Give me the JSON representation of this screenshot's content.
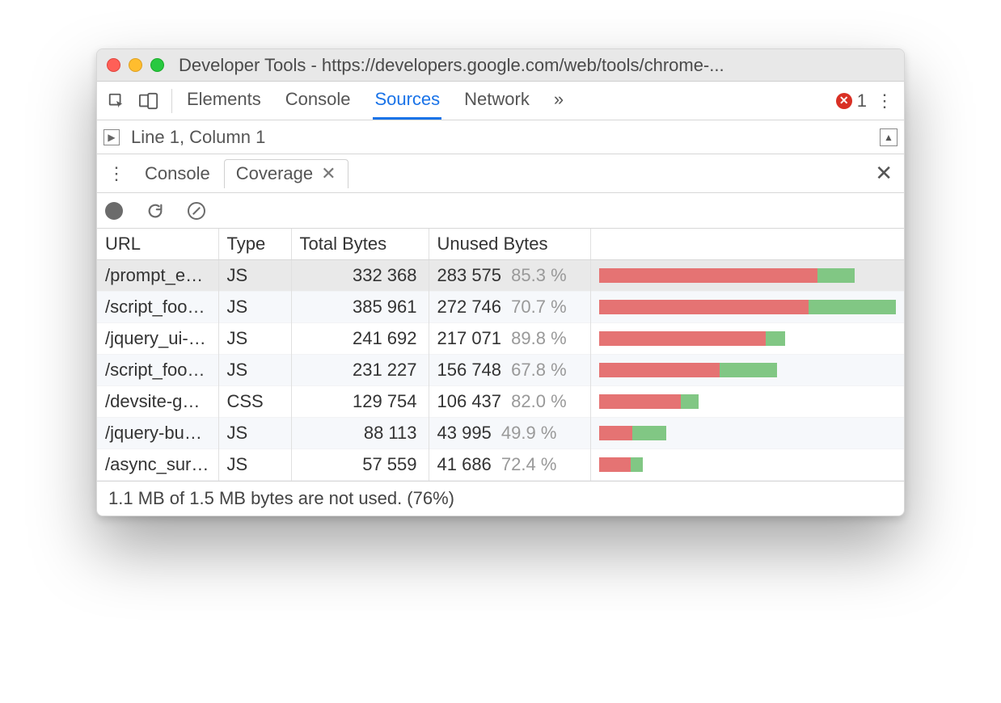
{
  "window": {
    "title": "Developer Tools - https://developers.google.com/web/tools/chrome-..."
  },
  "topbar": {
    "tabs": [
      "Elements",
      "Console",
      "Sources",
      "Network"
    ],
    "active_tab_index": 2,
    "overflow_glyph": "»",
    "error_count": "1"
  },
  "subrow": {
    "cursor_status": "Line 1, Column 1"
  },
  "drawer": {
    "tabs": [
      {
        "label": "Console",
        "active": false,
        "closable": false
      },
      {
        "label": "Coverage",
        "active": true,
        "closable": true
      }
    ]
  },
  "table": {
    "headers": {
      "url": "URL",
      "type": "Type",
      "total": "Total Bytes",
      "unused": "Unused Bytes"
    },
    "max_total": 385961,
    "rows": [
      {
        "url": "/prompt_emb",
        "type": "JS",
        "total": "332 368",
        "unused": "283 575",
        "pct": "85.3 %",
        "total_n": 332368,
        "unused_n": 283575,
        "selected": true
      },
      {
        "url": "/script_foot_c",
        "type": "JS",
        "total": "385 961",
        "unused": "272 746",
        "pct": "70.7 %",
        "total_n": 385961,
        "unused_n": 272746,
        "selected": false
      },
      {
        "url": "/jquery_ui-bun",
        "type": "JS",
        "total": "241 692",
        "unused": "217 071",
        "pct": "89.8 %",
        "total_n": 241692,
        "unused_n": 217071,
        "selected": false
      },
      {
        "url": "/script_foot.js",
        "type": "JS",
        "total": "231 227",
        "unused": "156 748",
        "pct": "67.8 %",
        "total_n": 231227,
        "unused_n": 156748,
        "selected": false
      },
      {
        "url": "/devsite-goog",
        "type": "CSS",
        "total": "129 754",
        "unused": "106 437",
        "pct": "82.0 %",
        "total_n": 129754,
        "unused_n": 106437,
        "selected": false
      },
      {
        "url": "/jquery-bundle",
        "type": "JS",
        "total": "88 113",
        "unused": "43 995",
        "pct": "49.9 %",
        "total_n": 88113,
        "unused_n": 43995,
        "selected": false
      },
      {
        "url": "/async_survey",
        "type": "JS",
        "total": "57 559",
        "unused": "41 686",
        "pct": "72.4 %",
        "total_n": 57559,
        "unused_n": 41686,
        "selected": false
      }
    ]
  },
  "footer": {
    "summary": "1.1 MB of 1.5 MB bytes are not used. (76%)"
  }
}
